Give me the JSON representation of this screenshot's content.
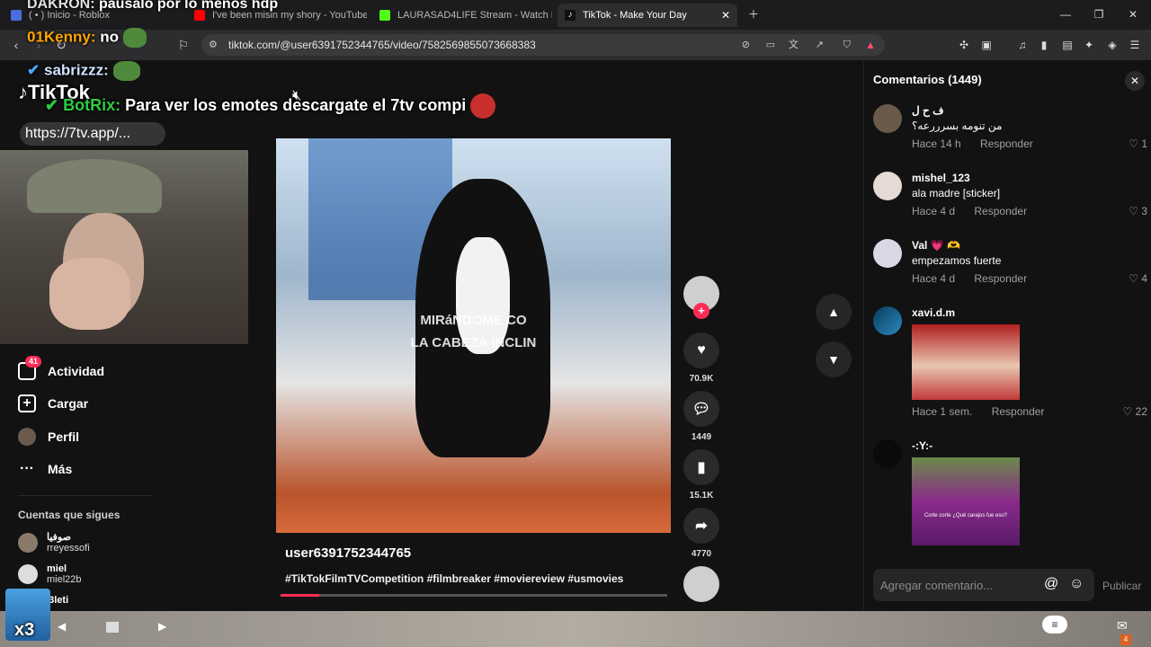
{
  "browser": {
    "tabs": [
      {
        "label": "( • ) Inicio - Roblox",
        "color": "#4a6ee0"
      },
      {
        "label": "I've been misin my shory - YouTube",
        "color": "#ff0000"
      },
      {
        "label": "LAURASAD4LIFE Stream - Watch Live",
        "color": "#53fc18"
      },
      {
        "label": "TikTok - Make Your Day",
        "color": "#ffffff"
      }
    ],
    "url": "tiktok.com/@user6391752344765/video/7582569855073668383"
  },
  "stream_overlay": {
    "chat_1_user": "DAKRON:",
    "chat_1_msg": "pausalo por lo menos hdp",
    "chat_2_user": "01Kenny:",
    "chat_2_msg": "no",
    "chat_3_user": "sabrizzz:",
    "chat_4_user": "BotRix:",
    "chat_4_msg": "Para ver los emotes descargate el 7tv compi",
    "link": "https://7tv.app/...",
    "tiktok_logo": "TikTok",
    "counter": "x3"
  },
  "nav": {
    "items": [
      {
        "label": "Actividad",
        "badge": "41"
      },
      {
        "label": "Cargar"
      },
      {
        "label": "Perfil"
      },
      {
        "label": "Más"
      }
    ],
    "following_title": "Cuentas que sigues",
    "following": [
      {
        "name": "صوفيا",
        "handle": "rreyessofi"
      },
      {
        "name": "miel",
        "handle": "miel22b"
      },
      {
        "name": "",
        "handle": "43leti"
      }
    ]
  },
  "video": {
    "caption_line1": "MIRáNDOME CO",
    "caption_line2": "LA CABEZA INCLIN",
    "author": "user6391752344765",
    "hashtags": "#TikTokFilmTVCompetition #filmbreaker #moviereview #usmovies",
    "progress": 0.1
  },
  "actions": {
    "likes": "70.9K",
    "comments": "1449",
    "saves": "15.1K",
    "shares": "4770"
  },
  "comments_panel": {
    "title": "Comentarios (1449)",
    "reply_label": "Responder",
    "input_placeholder": "Agregar comentario...",
    "publish_label": "Publicar",
    "items": [
      {
        "user": "ف ح ل",
        "text": "من تنومه بسرررعه؟",
        "time": "Hace 14 h",
        "likes": "1"
      },
      {
        "user": "mishel_123",
        "text": "ala madre [sticker]",
        "time": "Hace 4 d",
        "likes": "3"
      },
      {
        "user": "Val 💗 🫶",
        "text": "empezamos fuerte",
        "time": "Hace 4 d",
        "likes": "4"
      },
      {
        "user": "xavi.d.m",
        "text": "",
        "time": "Hace 1 sem.",
        "likes": "22"
      },
      {
        "user": "-:Y:-",
        "text": "",
        "time": "",
        "likes": ""
      }
    ],
    "sticker_caption": "Corte corte ¿Qué carajos fue eso?"
  },
  "taskbar": {
    "mail_badge": "4"
  }
}
